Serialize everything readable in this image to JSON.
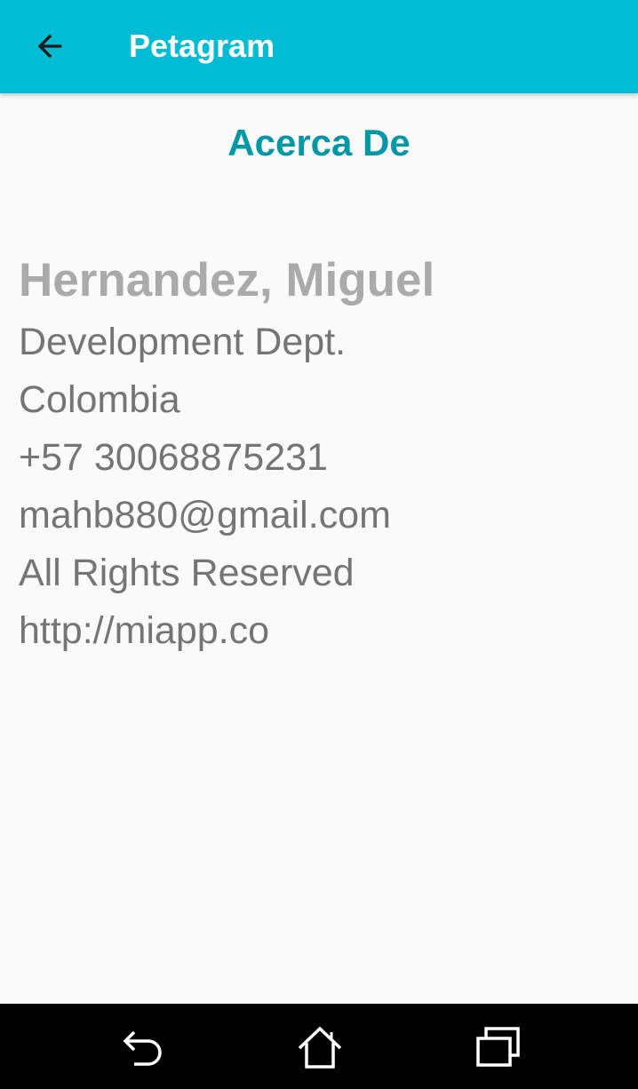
{
  "app_bar": {
    "title": "Petagram",
    "background": "#00bcd4",
    "back_icon": "arrow-left-icon"
  },
  "main": {
    "section_title": "Acerca De",
    "name": "Hernandez, Miguel",
    "details": [
      "Development Dept.",
      "Colombia",
      "+57 30068875231",
      "mahb880@gmail.com",
      "All Rights Reserved",
      "http://miapp.co"
    ],
    "accent_color": "#0097a7"
  },
  "system_nav": {
    "back_icon": "back-icon",
    "home_icon": "home-icon",
    "recents_icon": "recent-apps-icon"
  }
}
